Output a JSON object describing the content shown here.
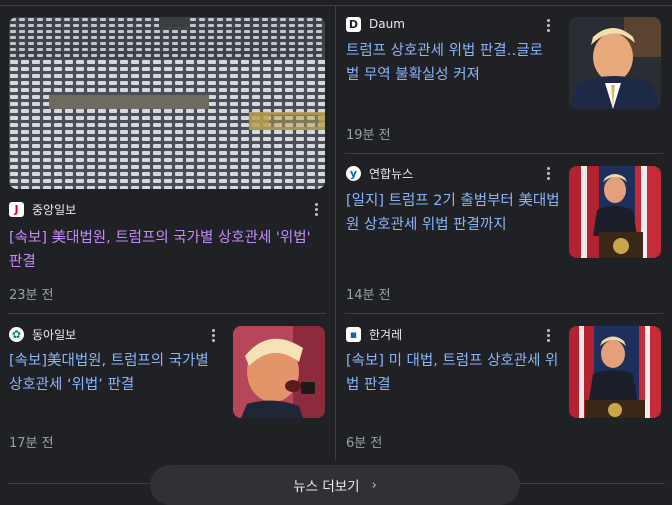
{
  "articles": [
    {
      "source": "중앙일보",
      "logo_letter": "J",
      "title": "[속보] 美대법원, 트럼프의 국가별 상호관세 '위법' 판결",
      "time": "23분 전",
      "visited": true
    },
    {
      "source": "Daum",
      "logo_letter": "D",
      "title": "트럼프 상호관세 위법 판결‥글로벌 무역 불확실성 커져",
      "time": "19분 전",
      "visited": false
    },
    {
      "source": "연합뉴스",
      "logo_letter": "y",
      "title": "[일지] 트럼프 2기 출범부터 美대법원 상호관세 위법 판결까지",
      "time": "14분 전",
      "visited": false
    },
    {
      "source": "동아일보",
      "logo_letter": "✿",
      "title": "[속보]美대법원, 트럼프의 국가별 상호관세 ‘위법’ 판결",
      "time": "17분 전",
      "visited": false
    },
    {
      "source": "한겨레",
      "logo_letter": "▪",
      "title": "[속보] 미 대법, 트럼프 상호관세 위법 판결",
      "time": "6분 전",
      "visited": false
    }
  ],
  "more_button": {
    "label": "뉴스 더보기",
    "chevron": "›"
  },
  "colors": {
    "link": "#8ab4f8",
    "visited": "#c58af9",
    "background": "#202124"
  }
}
